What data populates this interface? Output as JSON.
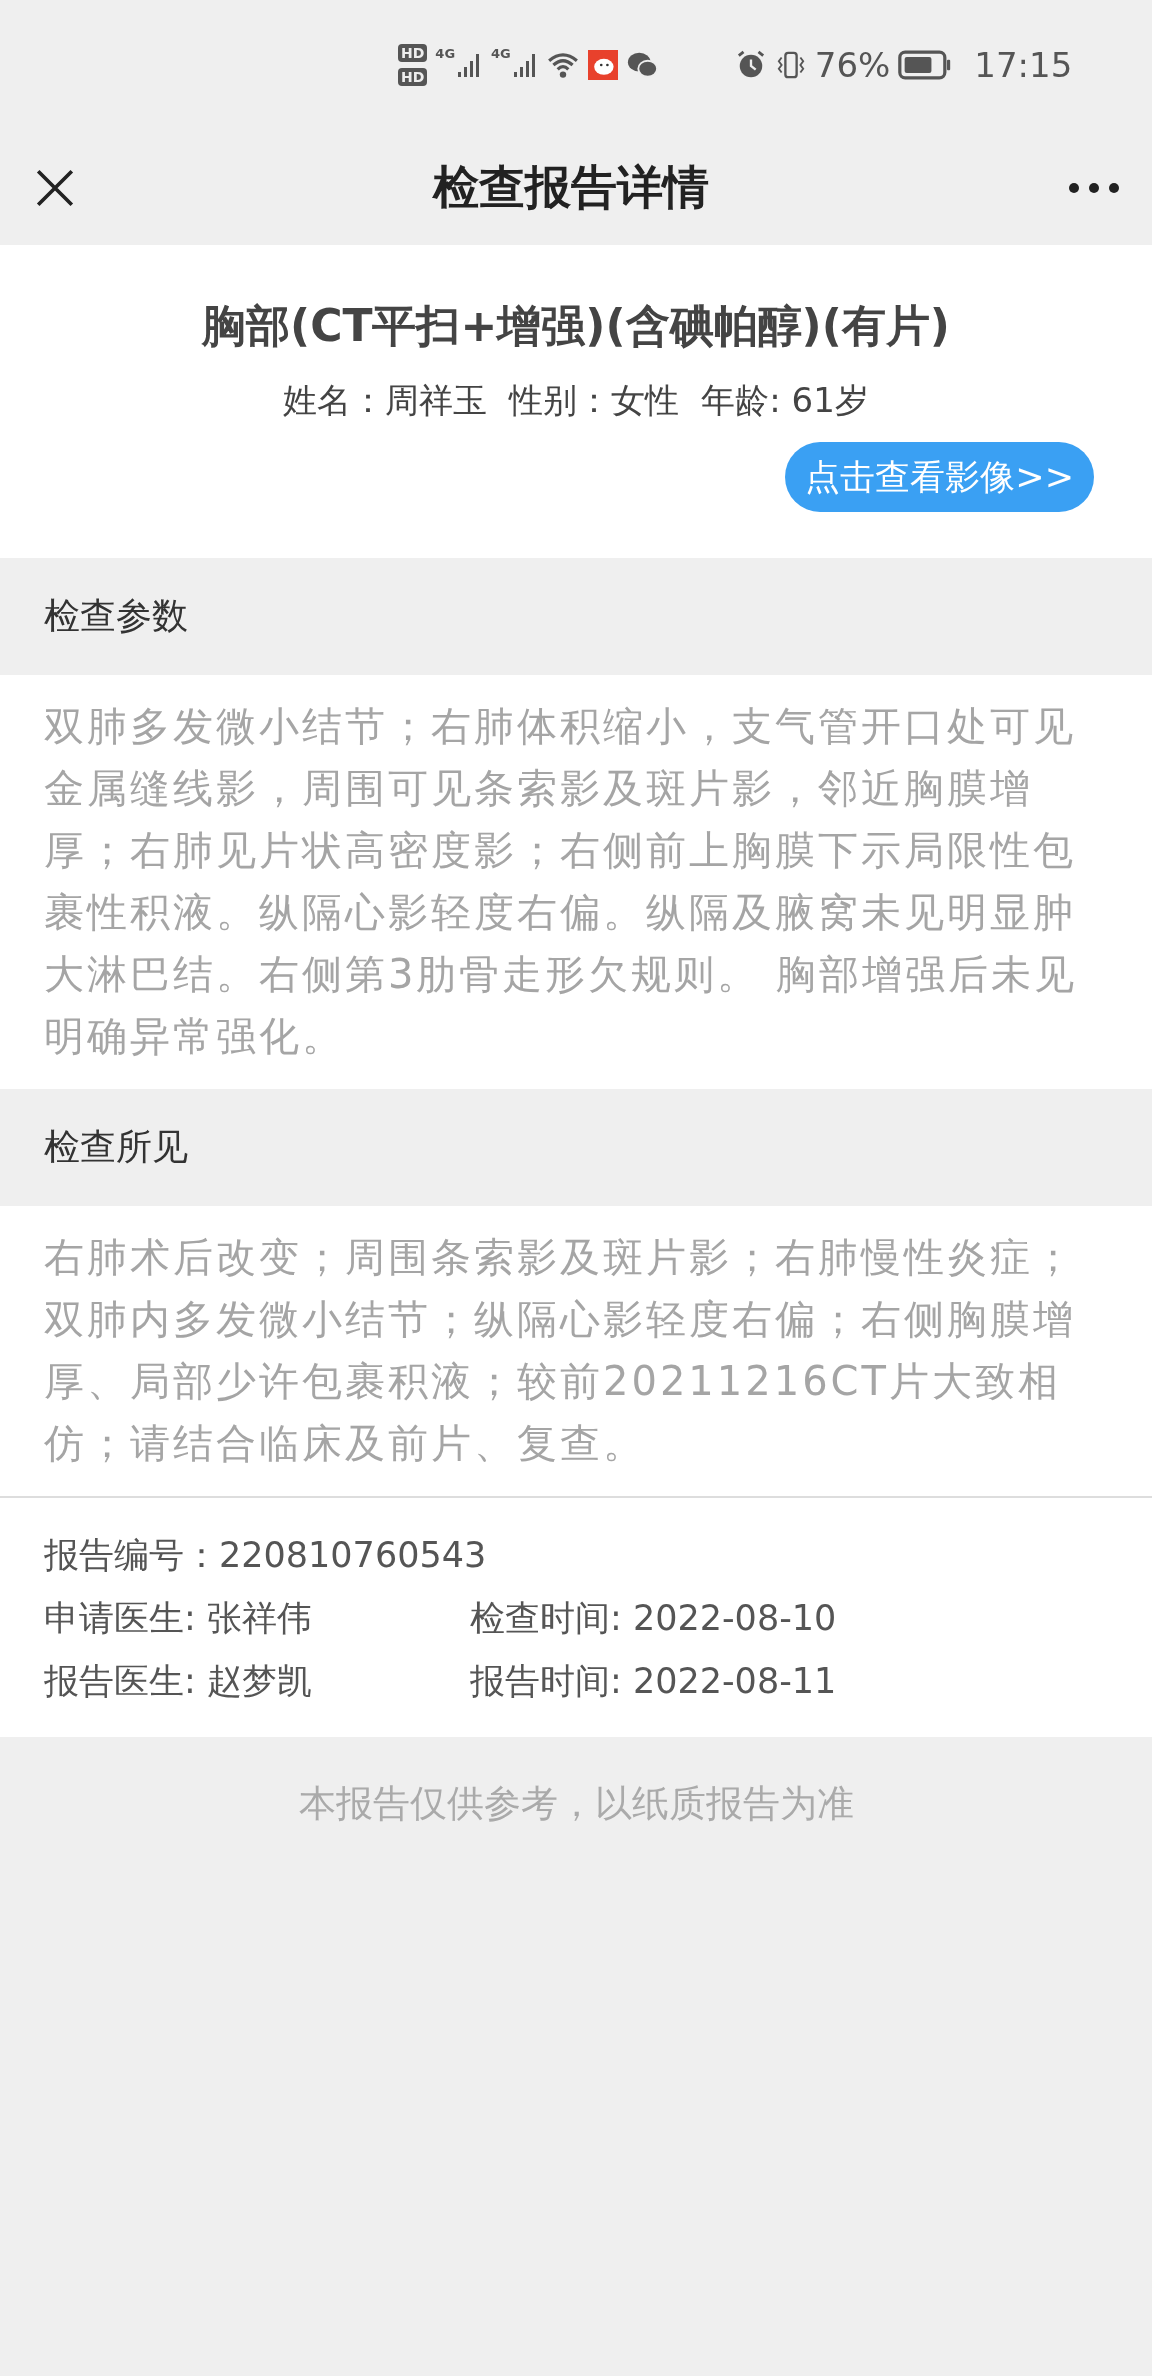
{
  "status_bar": {
    "battery": "76%",
    "time": "17:15",
    "sim_labels": [
      "HD",
      "HD"
    ],
    "network": [
      "4G",
      "4G"
    ]
  },
  "nav": {
    "title": "检查报告详情"
  },
  "report": {
    "title": "胸部(CT平扫+增强)(含碘帕醇)(有片)",
    "patient": [
      "姓名：周祥玉",
      "性别：女性",
      "年龄: 61岁"
    ],
    "view_images_button": "点击查看影像>>"
  },
  "sections": [
    {
      "heading": "检查参数",
      "body": "双肺多发微小结节；右肺体积缩小，支气管开口处可见金属缝线影，周围可见条索影及斑片影，邻近胸膜增厚；右肺见片状高密度影；右侧前上胸膜下示局限性包裹性积液。纵隔心影轻度右偏。纵隔及腋窝未见明显肿大淋巴结。右侧第3肋骨走形欠规则。 胸部增强后未见明确异常强化。"
    },
    {
      "heading": "检查所见",
      "body": "右肺术后改变；周围条索影及斑片影；右肺慢性炎症；双肺内多发微小结节；纵隔心影轻度右偏；右侧胸膜增厚、局部少许包裹积液；较前20211216CT片大致相仿；请结合临床及前片、复查。"
    }
  ],
  "info_rows": [
    [
      "报告编号：220810760543"
    ],
    [
      "申请医生: 张祥伟",
      "检查时间: 2022-08-10"
    ],
    [
      "报告医生: 赵梦凯",
      "报告时间: 2022-08-11"
    ]
  ],
  "disclaimer": "本报告仅供参考，以纸质报告为准"
}
